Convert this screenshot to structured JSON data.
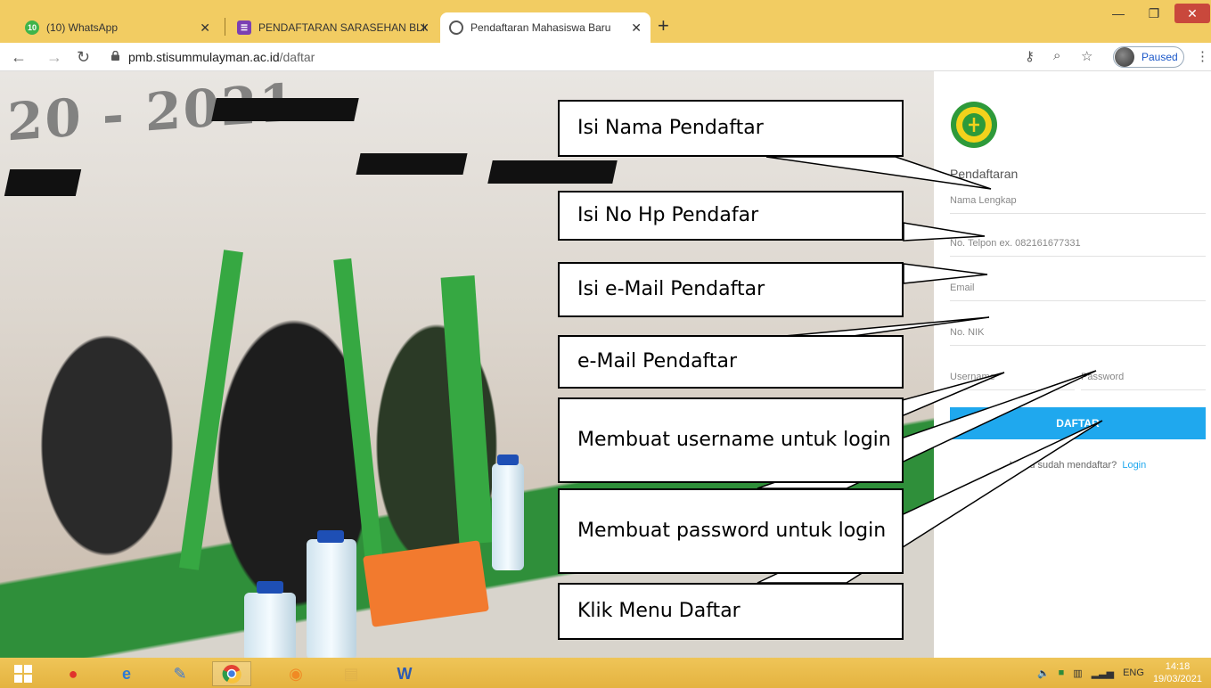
{
  "browser": {
    "tabs": [
      {
        "label": "(10) WhatsApp",
        "badge": "10",
        "active": false
      },
      {
        "label": "PENDAFTARAN SARASEHAN BLK",
        "active": false
      },
      {
        "label": "Pendaftaran Mahasiswa Baru",
        "active": true
      }
    ],
    "url_host": "pmb.stisummulayman.ac.id",
    "url_path": "/daftar",
    "profile_label": "Paused"
  },
  "page": {
    "photo_text": "20 - 2021",
    "form": {
      "title": "Pendaftaran",
      "fields": {
        "nama": "Nama Lengkap",
        "telpon": "No. Telpon ex. 082161677331",
        "email": "Email",
        "nik": "No. NIK",
        "username": "Username",
        "password": "Password"
      },
      "submit_label": "DAFTAR",
      "login_prompt": "Kamu sudah mendaftar?",
      "login_link": "Login"
    }
  },
  "annotations": {
    "nama": "Isi Nama  Pendaftar",
    "hp": "Isi No Hp Pendafar",
    "email": "Isi e-Mail Pendaftar",
    "email2": "e-Mail Pendaftar",
    "username": "Membuat username untuk login",
    "password": "Membuat password untuk login",
    "daftar": "Klik Menu Daftar"
  },
  "taskbar": {
    "language": "ENG",
    "time": "14:18",
    "date": "19/03/2021"
  },
  "colors": {
    "chrome_frame": "#f2cc62",
    "accent_button": "#1fa8ee",
    "taskbar": "#e4b340"
  }
}
